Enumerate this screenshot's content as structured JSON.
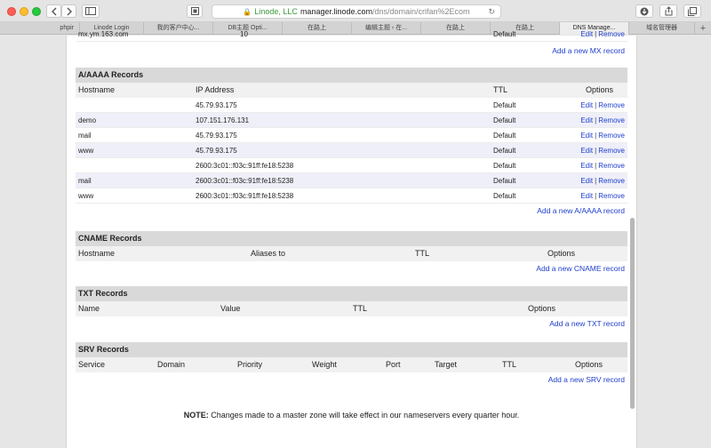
{
  "browser": {
    "url_owner": "Linode, LLC",
    "url_host": "manager.linode.com",
    "url_path": "/dns/domain/crifan%2Ecom",
    "tabs": [
      {
        "label": "phpir"
      },
      {
        "label": "Linode Login"
      },
      {
        "label": "我的客户中心..."
      },
      {
        "label": "DB主题 Opti..."
      },
      {
        "label": "在路上"
      },
      {
        "label": "编辑主题 ‹ 在..."
      },
      {
        "label": "在路上"
      },
      {
        "label": "在路上"
      },
      {
        "label": "DNS Manage..."
      },
      {
        "label": "域名管理器"
      }
    ]
  },
  "mx_partial": {
    "hostname": "mx.ym.163.com",
    "priority": "10",
    "ttl": "Default",
    "edit": "Edit",
    "remove": "Remove",
    "add_label": "Add a new MX record"
  },
  "a_records": {
    "title": "A/AAAA Records",
    "headers": {
      "hostname": "Hostname",
      "ip": "IP Address",
      "ttl": "TTL",
      "options": "Options"
    },
    "rows": [
      {
        "hostname": "",
        "ip": "45.79.93.175",
        "ttl": "Default"
      },
      {
        "hostname": "demo",
        "ip": "107.151.176.131",
        "ttl": "Default"
      },
      {
        "hostname": "mail",
        "ip": "45.79.93.175",
        "ttl": "Default"
      },
      {
        "hostname": "www",
        "ip": "45.79.93.175",
        "ttl": "Default"
      },
      {
        "hostname": "",
        "ip": "2600:3c01::f03c:91ff:fe18:5238",
        "ttl": "Default"
      },
      {
        "hostname": "mail",
        "ip": "2600:3c01::f03c:91ff:fe18:5238",
        "ttl": "Default"
      },
      {
        "hostname": "www",
        "ip": "2600:3c01::f03c:91ff:fe18:5238",
        "ttl": "Default"
      }
    ],
    "edit": "Edit",
    "remove": "Remove",
    "add_label": "Add a new A/AAAA record"
  },
  "cname_records": {
    "title": "CNAME Records",
    "headers": {
      "hostname": "Hostname",
      "aliases": "Aliases to",
      "ttl": "TTL",
      "options": "Options"
    },
    "add_label": "Add a new CNAME record"
  },
  "txt_records": {
    "title": "TXT Records",
    "headers": {
      "name": "Name",
      "value": "Value",
      "ttl": "TTL",
      "options": "Options"
    },
    "add_label": "Add a new TXT record"
  },
  "srv_records": {
    "title": "SRV Records",
    "headers": {
      "service": "Service",
      "domain": "Domain",
      "priority": "Priority",
      "weight": "Weight",
      "port": "Port",
      "target": "Target",
      "ttl": "TTL",
      "options": "Options"
    },
    "add_label": "Add a new SRV record"
  },
  "note": {
    "label": "NOTE:",
    "text": " Changes made to a master zone will take effect in our nameservers every quarter hour."
  }
}
